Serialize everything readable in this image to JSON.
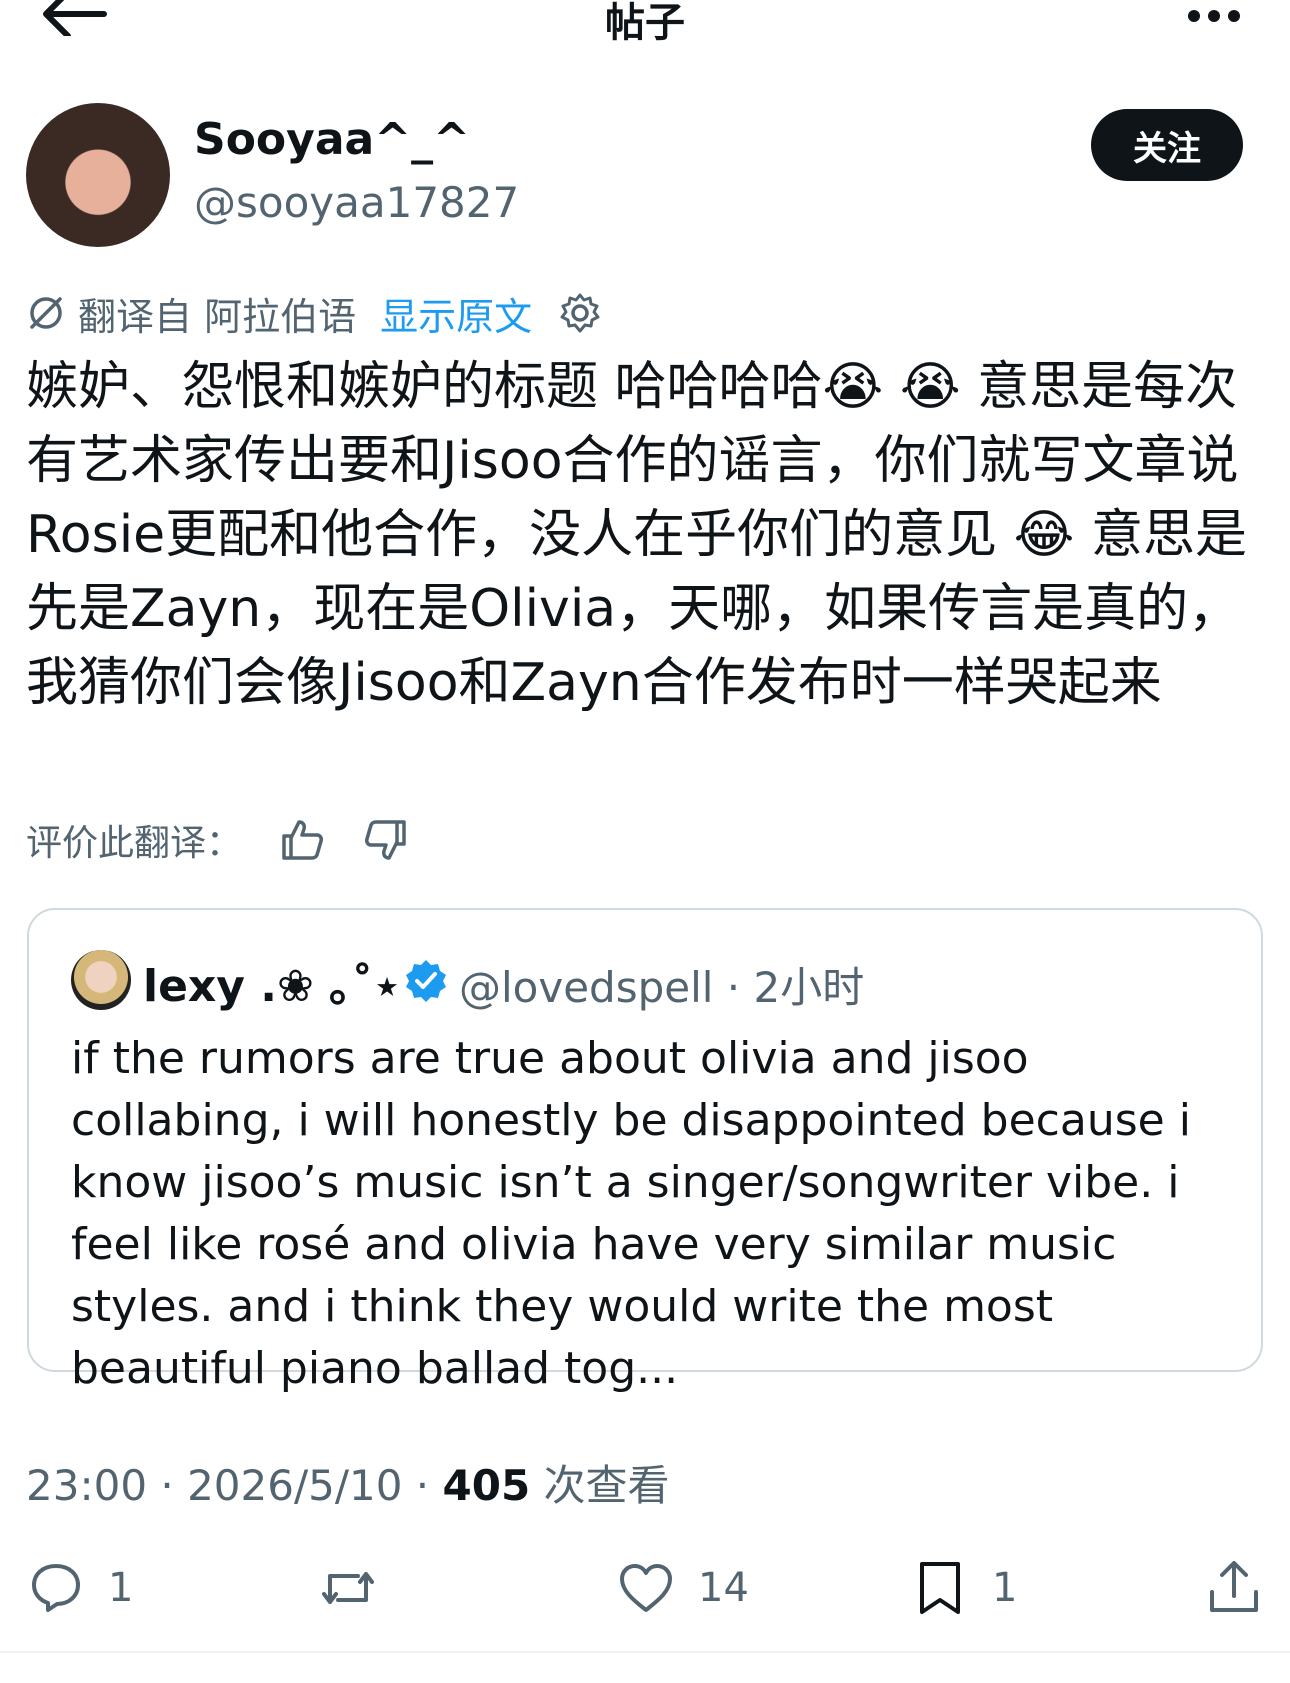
{
  "header": {
    "title": "帖子"
  },
  "author": {
    "display_name": "Sooyaa^_^",
    "handle": "@sooyaa17827",
    "follow_label": "关注"
  },
  "translation": {
    "translated_from": "翻译自 阿拉伯语",
    "show_original": "显示原文"
  },
  "post": {
    "text": "嫉妒、怨恨和嫉妒的标题 哈哈哈哈😭 😭 意思是每次有艺术家传出要和Jisoo合作的谣言，你们就写文章说Rosie更配和他合作，没人在乎你们的意见 😂 意思是先是Zayn，现在是Olivia，天哪，如果传言是真的，我猜你们会像Jisoo和Zayn合作发布时一样哭起来"
  },
  "rate_translation": {
    "label": "评价此翻译："
  },
  "quoted": {
    "name": "lexy .❀ ｡˚⋆",
    "handle_time": "@lovedspell · 2小时",
    "text": "if the rumors are true about olivia and jisoo collabing, i will honestly be disappointed because i know jisoo’s music isn’t a singer/songwriter vibe. i feel like rosé and olivia have very similar music styles. and i think they would write the most beautiful piano ballad tog..."
  },
  "meta": {
    "time_date": "23:00 · 2026/5/10 · ",
    "views": "405",
    "views_label": " 次查看"
  },
  "actions": {
    "replies": "1",
    "likes": "14",
    "bookmarks": "1"
  },
  "colors": {
    "accent": "#1d9bf0",
    "text": "#0f1419",
    "secondary": "#536471",
    "border": "#cfd9de"
  }
}
